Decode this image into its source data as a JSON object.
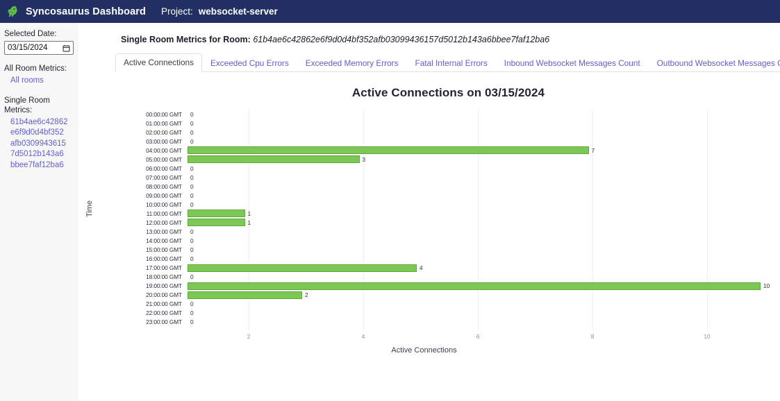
{
  "navbar": {
    "logo_icon": "dinosaur-logo",
    "brand": "Syncosaurus Dashboard",
    "project_label": "Project:",
    "project_name": "websocket-server",
    "background_color": "#222f62"
  },
  "sidebar": {
    "selected_date_label": "Selected Date:",
    "selected_date_value": "03/15/2024",
    "calendar_icon": "calendar-icon",
    "all_room_metrics_label": "All Room Metrics:",
    "all_rooms_link": "All rooms",
    "single_room_metrics_label": "Single Room Metrics:",
    "room_id": "61b4ae6c42862e6f9d0d4bf352afb03099436157d5012b143a6bbee7faf12ba6",
    "link_color": "#6060c8"
  },
  "main": {
    "room_heading_label": "Single Room Metrics for Room:",
    "room_heading_id": "61b4ae6c42862e6f9d0d4bf352afb03099436157d5012b143a6bbee7faf12ba6"
  },
  "tabs": [
    {
      "label": "Active Connections",
      "active": true
    },
    {
      "label": "Exceeded Cpu Errors",
      "active": false
    },
    {
      "label": "Exceeded Memory Errors",
      "active": false
    },
    {
      "label": "Fatal Internal Errors",
      "active": false
    },
    {
      "label": "Inbound Websocket Messages Count",
      "active": false
    },
    {
      "label": "Outbound Websocket Messages Count",
      "active": false
    }
  ],
  "chart_data": {
    "type": "bar",
    "orientation": "horizontal",
    "title": "Active Connections on 03/15/2024",
    "xlabel": "Active Connections",
    "ylabel": "Time",
    "xlim": [
      0,
      10
    ],
    "xticks": [
      2,
      4,
      6,
      8,
      10
    ],
    "grid": true,
    "legend": false,
    "bar_color": "#7dc855",
    "bar_border_color": "#5aaa3c",
    "categories": [
      "00:00:00 GMT",
      "01:00:00 GMT",
      "02:00:00 GMT",
      "03:00:00 GMT",
      "04:00:00 GMT",
      "05:00:00 GMT",
      "06:00:00 GMT",
      "07:00:00 GMT",
      "08:00:00 GMT",
      "09:00:00 GMT",
      "10:00:00 GMT",
      "11:00:00 GMT",
      "12:00:00 GMT",
      "13:00:00 GMT",
      "14:00:00 GMT",
      "15:00:00 GMT",
      "16:00:00 GMT",
      "17:00:00 GMT",
      "18:00:00 GMT",
      "19:00:00 GMT",
      "20:00:00 GMT",
      "21:00:00 GMT",
      "22:00:00 GMT",
      "23:00:00 GMT"
    ],
    "values": [
      0,
      0,
      0,
      0,
      7,
      3,
      0,
      0,
      0,
      0,
      0,
      1,
      1,
      0,
      0,
      0,
      0,
      4,
      0,
      10,
      2,
      0,
      0,
      0
    ]
  }
}
